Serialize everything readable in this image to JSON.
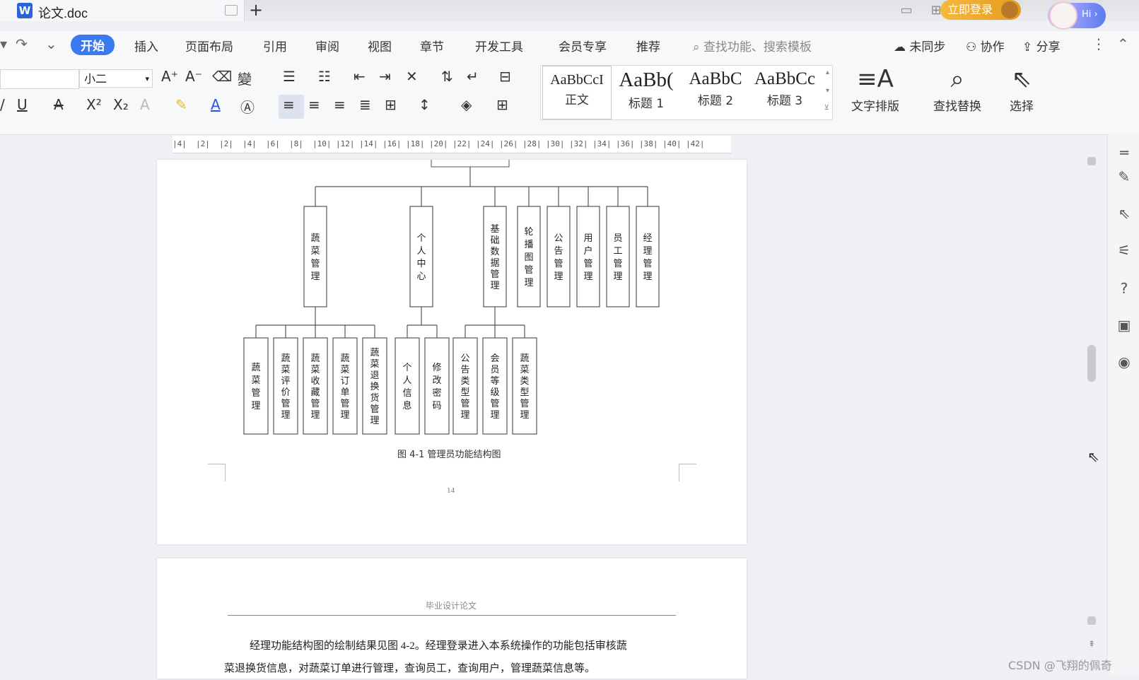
{
  "titlebar": {
    "doc_title": "论文.doc",
    "new_tab_icon": "+",
    "login_label": "立即登录",
    "hi_label": "Hi ›"
  },
  "menu": {
    "items": [
      "开始",
      "插入",
      "页面布局",
      "引用",
      "审阅",
      "视图",
      "章节",
      "开发工具",
      "会员专享",
      "推荐"
    ],
    "search_placeholder": "查找功能、搜索模板",
    "sync_label": "未同步",
    "collab_label": "协作",
    "share_label": "分享"
  },
  "ribbon": {
    "font_size": "小二",
    "styles": [
      {
        "sample": "AaBbCcI",
        "label": "正文"
      },
      {
        "sample": "AaBb(",
        "label": "标题 1"
      },
      {
        "sample": "AaBbC",
        "label": "标题 2"
      },
      {
        "sample": "AaBbCc",
        "label": "标题 3"
      }
    ],
    "text_layout_label": "文字排版",
    "find_replace_label": "查找替换",
    "select_label": "选择"
  },
  "ruler": {
    "labels": [
      "|4|",
      "|2|",
      "|2|",
      "|4|",
      "|6|",
      "|8|",
      "|10|",
      "|12|",
      "|14|",
      "|16|",
      "|18|",
      "|20|",
      "|22|",
      "|24|",
      "|26|",
      "|28|",
      "|30|",
      "|32|",
      "|34|",
      "|36|",
      "|38|",
      "|40|",
      "|42|"
    ]
  },
  "diagram": {
    "level1": [
      "蔬菜管理",
      "个人中心",
      "基础数据管理",
      "轮播图管理",
      "公告管理",
      "用户管理",
      "员工管理",
      "经理管理"
    ],
    "level2_vegetable": [
      "蔬菜管理",
      "蔬菜评价管理",
      "蔬菜收藏管理",
      "蔬菜订单管理",
      "蔬菜退换货管理"
    ],
    "level2_personal": [
      "个人信息",
      "修改密码"
    ],
    "level2_basic": [
      "公告类型管理",
      "会员等级管理",
      "蔬菜类型管理"
    ],
    "caption": "图 4-1  管理员功能结构图",
    "page_number": "14"
  },
  "page2": {
    "header": "毕业设计论文",
    "paragraph_line1": "经理功能结构图的绘制结果见图 4-2。经理登录进入本系统操作的功能包括审核蔬",
    "paragraph_line2": "菜退换货信息，对蔬菜订单进行管理，查询员工，查询用户，管理蔬菜信息等。"
  },
  "watermark": "CSDN @飞翔的佩奇",
  "colors": {
    "accent": "#3a7af0",
    "login": "#f0a829"
  }
}
